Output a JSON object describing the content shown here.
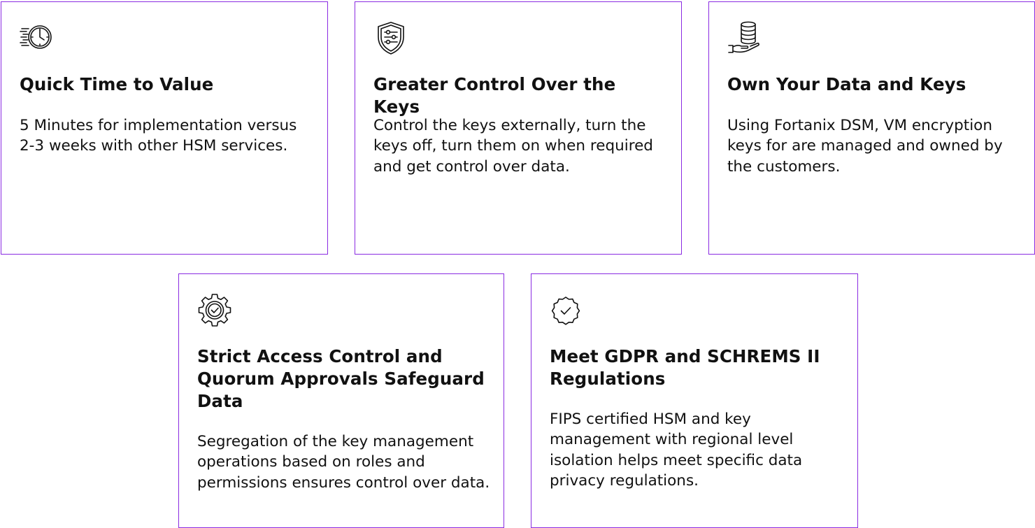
{
  "cards": [
    {
      "icon": "fast-clock-icon",
      "title": "Quick Time to Value",
      "description": "5 Minutes for implementation versus 2-3 weeks with other HSM services."
    },
    {
      "icon": "shield-settings-icon",
      "title": "Greater Control Over the Keys",
      "description": "Control the keys externally, turn the keys off, turn them on when required and get control over data."
    },
    {
      "icon": "hand-database-icon",
      "title": "Own Your Data and Keys",
      "description": "Using Fortanix DSM, VM encryption keys for are managed and owned by the customers."
    },
    {
      "icon": "gear-check-icon",
      "title": "Strict Access Control and Quorum Approvals Safeguard Data",
      "description": "Segregation of the key man­agement operations based on roles and permissions ensures control over data."
    },
    {
      "icon": "verified-badge-icon",
      "title": "Meet GDPR and SCHREMS II Regulations",
      "description": "FIPS certified HSM and key management with regional level isolation helps meet specific data privacy regulations."
    }
  ],
  "colors": {
    "border": "#8a2be2",
    "text": "#111111",
    "background": "#ffffff"
  }
}
